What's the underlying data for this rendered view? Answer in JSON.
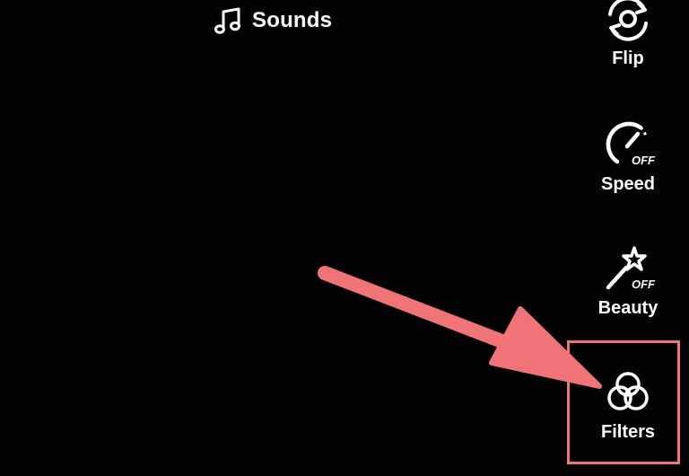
{
  "toolbar": {
    "sounds_label": "Sounds",
    "sounds_icon": "music-note-icon"
  },
  "side_menu": {
    "items": [
      {
        "label": "Flip",
        "icon": "flip-camera-icon"
      },
      {
        "label": "Speed",
        "icon": "speedometer-icon",
        "badge": "OFF"
      },
      {
        "label": "Beauty",
        "icon": "magic-wand-icon",
        "badge": "OFF"
      },
      {
        "label": "Filters",
        "icon": "filters-icon"
      }
    ]
  },
  "annotation": {
    "highlight_target": "Filters",
    "color": "#f07377"
  },
  "colors": {
    "background": "#000000",
    "foreground": "#ffffff",
    "annotation": "#f07377"
  }
}
